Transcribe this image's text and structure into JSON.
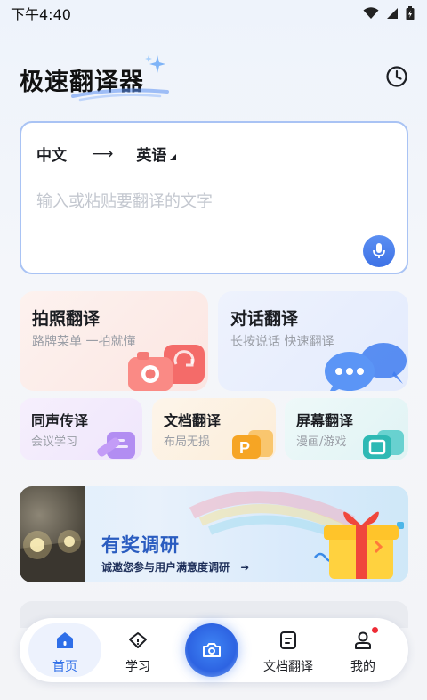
{
  "status_bar": {
    "time": "下午4:40"
  },
  "header": {
    "title": "极速翻译器"
  },
  "translator": {
    "source_lang": "中文",
    "arrow": "⟶",
    "target_lang": "英语",
    "placeholder": "输入或粘贴要翻译的文字"
  },
  "features": {
    "photo": {
      "title": "拍照翻译",
      "subtitle": "路牌菜单 一拍就懂"
    },
    "dialog": {
      "title": "对话翻译",
      "subtitle": "长按说话 快速翻译"
    },
    "simultaneous": {
      "title": "同声传译",
      "subtitle": "会议学习"
    },
    "document": {
      "title": "文档翻译",
      "subtitle": "布局无损"
    },
    "screen": {
      "title": "屏幕翻译",
      "subtitle": "漫画/游戏"
    }
  },
  "banner": {
    "title": "有奖调研",
    "subtitle": "诚邀您参与用户满意度调研",
    "arrow": "➜"
  },
  "tabbar": {
    "home": "首页",
    "study": "学习",
    "document": "文档翻译",
    "mine": "我的"
  },
  "colors": {
    "accent": "#2f6fe8",
    "input_border": "#a9c3f4",
    "notification_dot": "#ee2b35"
  }
}
